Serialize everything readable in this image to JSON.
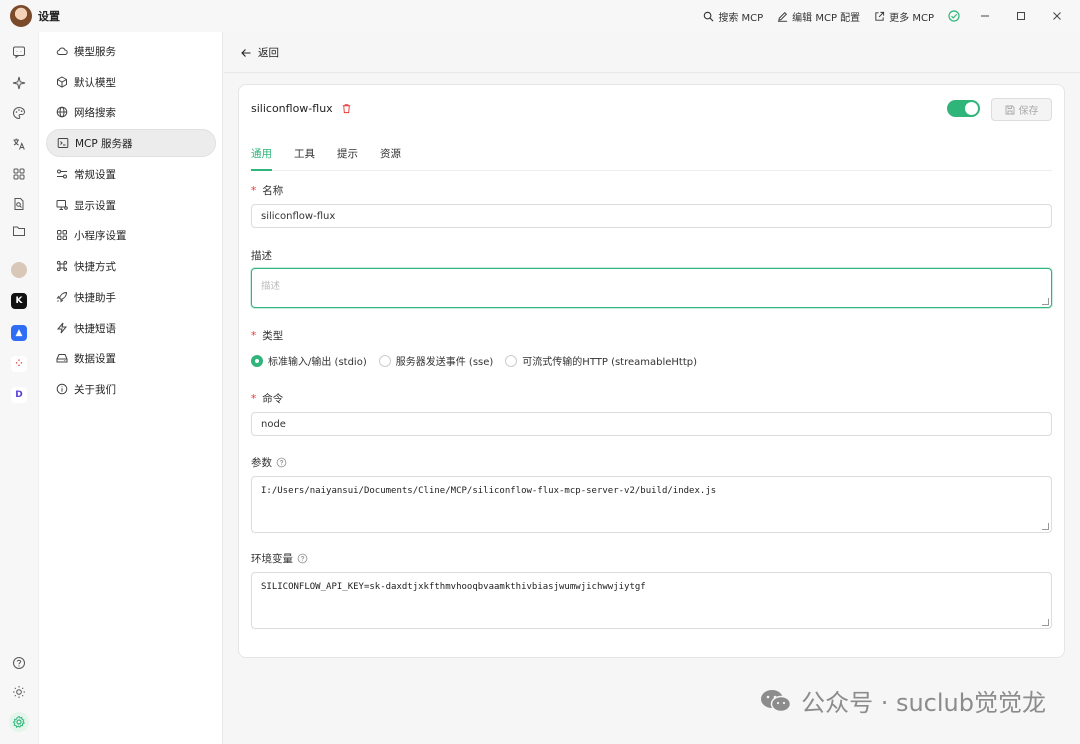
{
  "app": {
    "title": "设置"
  },
  "titlebar": {
    "search_mcp": "搜索 MCP",
    "edit_mcp_config": "编辑 MCP 配置",
    "more_mcp": "更多 MCP"
  },
  "sidebar": {
    "items": [
      {
        "label": "模型服务",
        "icon": "cloud-icon"
      },
      {
        "label": "默认模型",
        "icon": "box-icon"
      },
      {
        "label": "网络搜索",
        "icon": "globe-icon"
      },
      {
        "label": "MCP 服务器",
        "icon": "terminal-icon"
      },
      {
        "label": "常规设置",
        "icon": "sliders-icon"
      },
      {
        "label": "显示设置",
        "icon": "monitor-icon"
      },
      {
        "label": "小程序设置",
        "icon": "grid-icon"
      },
      {
        "label": "快捷方式",
        "icon": "command-icon"
      },
      {
        "label": "快捷助手",
        "icon": "rocket-icon"
      },
      {
        "label": "快捷短语",
        "icon": "zap-icon"
      },
      {
        "label": "数据设置",
        "icon": "hard-drive-icon"
      },
      {
        "label": "关于我们",
        "icon": "info-icon"
      }
    ]
  },
  "main": {
    "back_label": "返回",
    "server_name": "siliconflow-flux",
    "save_label": "保存",
    "enabled": true,
    "tabs": [
      {
        "label": "通用"
      },
      {
        "label": "工具"
      },
      {
        "label": "提示"
      },
      {
        "label": "资源"
      }
    ],
    "form": {
      "name_label": "名称",
      "name_value": "siliconflow-flux",
      "desc_label": "描述",
      "desc_placeholder": "描述",
      "type_label": "类型",
      "type_options": [
        {
          "label": "标准输入/输出 (stdio)",
          "selected": true
        },
        {
          "label": "服务器发送事件 (sse)",
          "selected": false
        },
        {
          "label": "可流式传输的HTTP (streamableHttp)",
          "selected": false
        }
      ],
      "command_label": "命令",
      "command_value": "node",
      "args_label": "参数",
      "args_value": "I:/Users/naiyansui/Documents/Cline/MCP/siliconflow-flux-mcp-server-v2/build/index.js",
      "env_label": "环境变量",
      "env_value": "SILICONFLOW_API_KEY=sk-daxdtjxkfthmvhooqbvaamkthivbiasjwumwjichwwjiytgf"
    }
  },
  "watermark": "公众号 · suclub觉觉龙",
  "colors": {
    "accent": "#2fb57a",
    "danger": "#e33333"
  }
}
